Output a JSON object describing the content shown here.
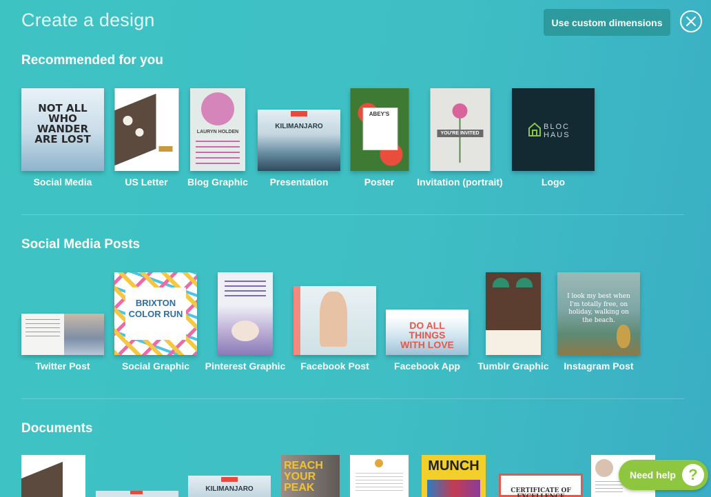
{
  "header": {
    "title": "Create a design",
    "custom_dimensions_label": "Use custom dimensions"
  },
  "sections": {
    "recommended": {
      "title": "Recommended for you",
      "items": [
        "Social Media",
        "US Letter",
        "Blog Graphic",
        "Presentation",
        "Poster",
        "Invitation (portrait)",
        "Logo"
      ]
    },
    "social": {
      "title": "Social Media Posts",
      "items": [
        "Twitter Post",
        "Social Graphic",
        "Pinterest Graphic",
        "Facebook Post",
        "Facebook App",
        "Tumblr Graphic",
        "Instagram Post"
      ]
    },
    "documents": {
      "title": "Documents"
    }
  },
  "thumb_text": {
    "social_media": "NOT ALL WHO WANDER ARE LOST",
    "presentation": "KILIMANJARO",
    "poster": "ABEY'S",
    "invitation": "YOU'RE INVITED",
    "logo_line1": "BLOC",
    "logo_line2": "HAUS",
    "blog": "LAURYN HOLDEN",
    "brixton_1": "BRIXTON",
    "brixton_2": "COLOR RUN",
    "fb_app": "DO ALL THINGS WITH LOVE",
    "instagram": "I look my best when I'm totally free, on holiday, walking on the beach.",
    "doc_reach": "REACH YOUR PEAK",
    "doc_munch": "MUNCH",
    "doc_certificate": "CERTIFICATE OF EXCELLENCE",
    "doc_kilimanjaro": "KILIMANJARO"
  },
  "help": {
    "label": "Need help",
    "icon_glyph": "?"
  },
  "icons": {
    "close": "close-icon",
    "help": "question-icon"
  },
  "colors": {
    "background": "#3ec3c3",
    "button": "#2d9a9d",
    "help": "#8ec63f"
  }
}
